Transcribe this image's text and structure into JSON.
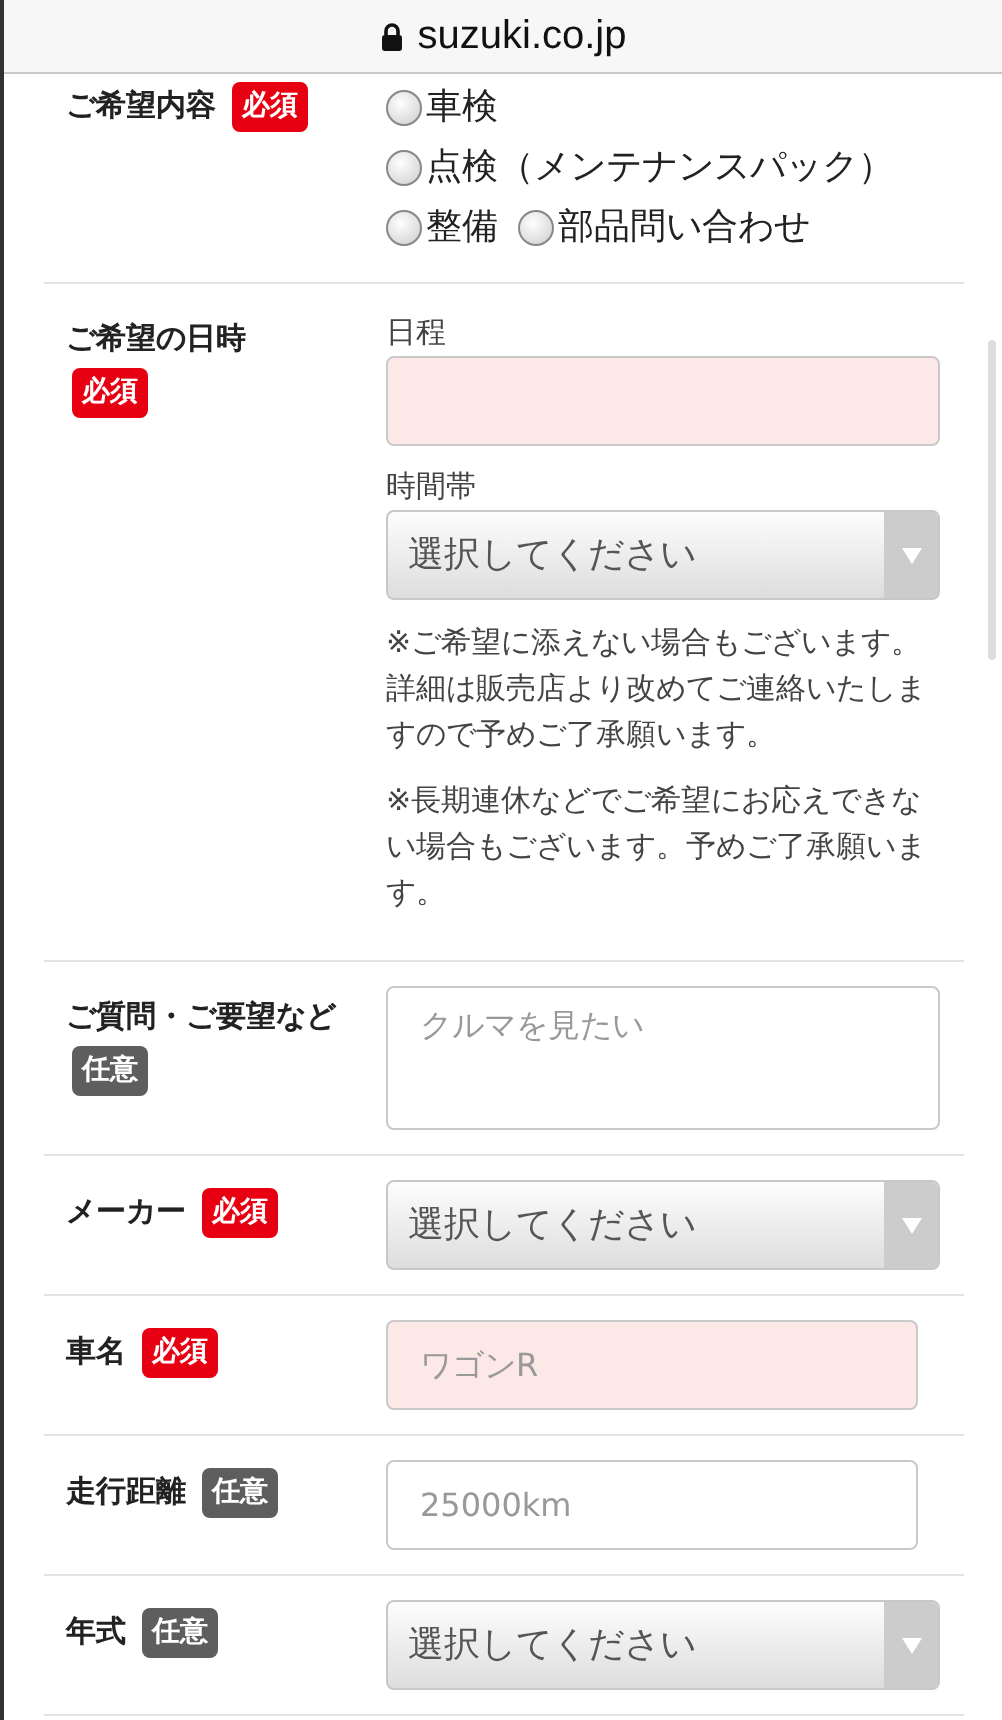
{
  "address_bar": {
    "domain": "suzuki.co.jp"
  },
  "rows": [
    {
      "label": "ご希望内容",
      "badge": {
        "text": "必須",
        "kind": "required"
      },
      "fields": [
        {
          "kind": "radio_group",
          "lines": [
            [
              {
                "label": "車検",
                "selected": false
              }
            ],
            [
              {
                "label": "点検（メンテナンスパック）",
                "selected": false
              }
            ],
            [
              {
                "label": "整備",
                "selected": false
              },
              {
                "label": "部品問い合わせ",
                "selected": false
              }
            ]
          ]
        }
      ]
    },
    {
      "label": "ご希望の日時",
      "badge": {
        "text": "必須",
        "kind": "required"
      },
      "fields": [
        {
          "kind": "date",
          "caption": "日程",
          "highlighted": true
        },
        {
          "kind": "select",
          "caption": "時間帯",
          "value": "選択してください"
        },
        {
          "kind": "notes",
          "paragraphs": [
            [
              "※ご希望に添えない場合もございます。",
              "詳細は販売店より改めてご連絡いたしますので予めご了承願います。"
            ],
            [
              "※長期連休などでご希望にお応えできない場合もございます。予めご了承願います。"
            ]
          ]
        }
      ]
    },
    {
      "label": "ご質問・ご要望など",
      "badge": {
        "text": "任意",
        "kind": "optional"
      },
      "fields": [
        {
          "kind": "textarea",
          "placeholder": "クルマを見たい",
          "highlighted": false
        }
      ]
    },
    {
      "label": "メーカー",
      "badge": {
        "text": "必須",
        "kind": "required"
      },
      "fields": [
        {
          "kind": "select",
          "value": "選択してください"
        }
      ]
    },
    {
      "label": "車名",
      "badge": {
        "text": "必須",
        "kind": "required"
      },
      "fields": [
        {
          "kind": "text",
          "placeholder": "ワゴンR",
          "highlighted": true
        }
      ]
    },
    {
      "label": "走行距離",
      "badge": {
        "text": "任意",
        "kind": "optional"
      },
      "fields": [
        {
          "kind": "text",
          "placeholder": "25000km",
          "highlighted": false
        }
      ]
    },
    {
      "label": "年式",
      "badge": {
        "text": "任意",
        "kind": "optional"
      },
      "fields": [
        {
          "kind": "select",
          "value": "選択してください"
        }
      ]
    }
  ]
}
